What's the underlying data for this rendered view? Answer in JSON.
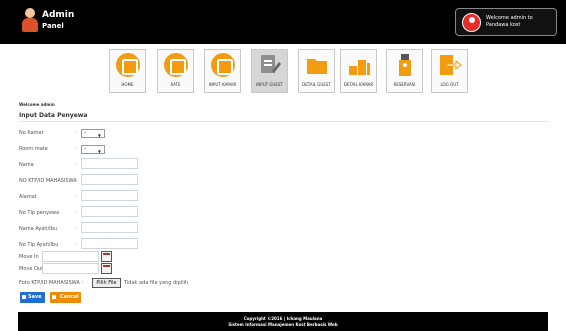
{
  "app": {
    "brand_line1": "Admin",
    "brand_line2": "Panel",
    "welcome_text": "Welcome admin to Pandawa kost"
  },
  "menu": [
    {
      "label": "HOME",
      "icon": "home-icon",
      "color": "#f39c12"
    },
    {
      "label": "RATE",
      "icon": "rate-icon",
      "color": "#f39c12"
    },
    {
      "label": "INPUT KAMAR",
      "icon": "bed-icon",
      "color": "#f39c12"
    },
    {
      "label": "INPUT GUEST",
      "icon": "document-edit-icon",
      "color": "#8e8e8e"
    },
    {
      "label": "DETAIL GUEST",
      "icon": "folder-icon",
      "color": "#f39c12"
    },
    {
      "label": "DETAIL KAMAR",
      "icon": "building-icon",
      "color": "#f39c12"
    },
    {
      "label": "RESERVASI",
      "icon": "reservation-icon",
      "color": "#f39c12"
    },
    {
      "label": "LOG OUT",
      "icon": "logout-icon",
      "color": "#f39c12"
    }
  ],
  "page": {
    "welcome": "Welcome admin",
    "section_title": "Input Data Penyewa"
  },
  "form": {
    "fields": [
      {
        "label": "No Kamar",
        "colon": ":",
        "type": "select",
        "value": "–"
      },
      {
        "label": "Room mate",
        "colon": ":",
        "type": "select",
        "value": "–"
      },
      {
        "label": "Nama",
        "colon": ":",
        "type": "text",
        "value": ""
      },
      {
        "label": "NO KTP/ID MAHASISWA",
        "colon": ":",
        "type": "text",
        "value": ""
      },
      {
        "label": "Alamat",
        "colon": ":",
        "type": "text",
        "value": ""
      },
      {
        "label": "No Tlp penyewa",
        "colon": ":",
        "type": "text",
        "value": ""
      },
      {
        "label": "Nama Ayah/Ibu",
        "colon": ":",
        "type": "text",
        "value": ""
      },
      {
        "label": "No Tlp Ayah/Ibu",
        "colon": ":",
        "type": "text",
        "value": ""
      }
    ],
    "move_in_label": "Move In",
    "move_out_label": "Move Out",
    "file_label": "Foto KTP/ID MAHASISWA :",
    "file_button": "Pilih File",
    "file_status": "Tidak ada file yang dipilih",
    "save_label": "Save",
    "cancel_label": "Cancel"
  },
  "footer": {
    "line1": "Copyright ©2016 | Ichang Maulana",
    "line2": "Sistem Informasi Manajemen Kost Berbasis Web"
  }
}
